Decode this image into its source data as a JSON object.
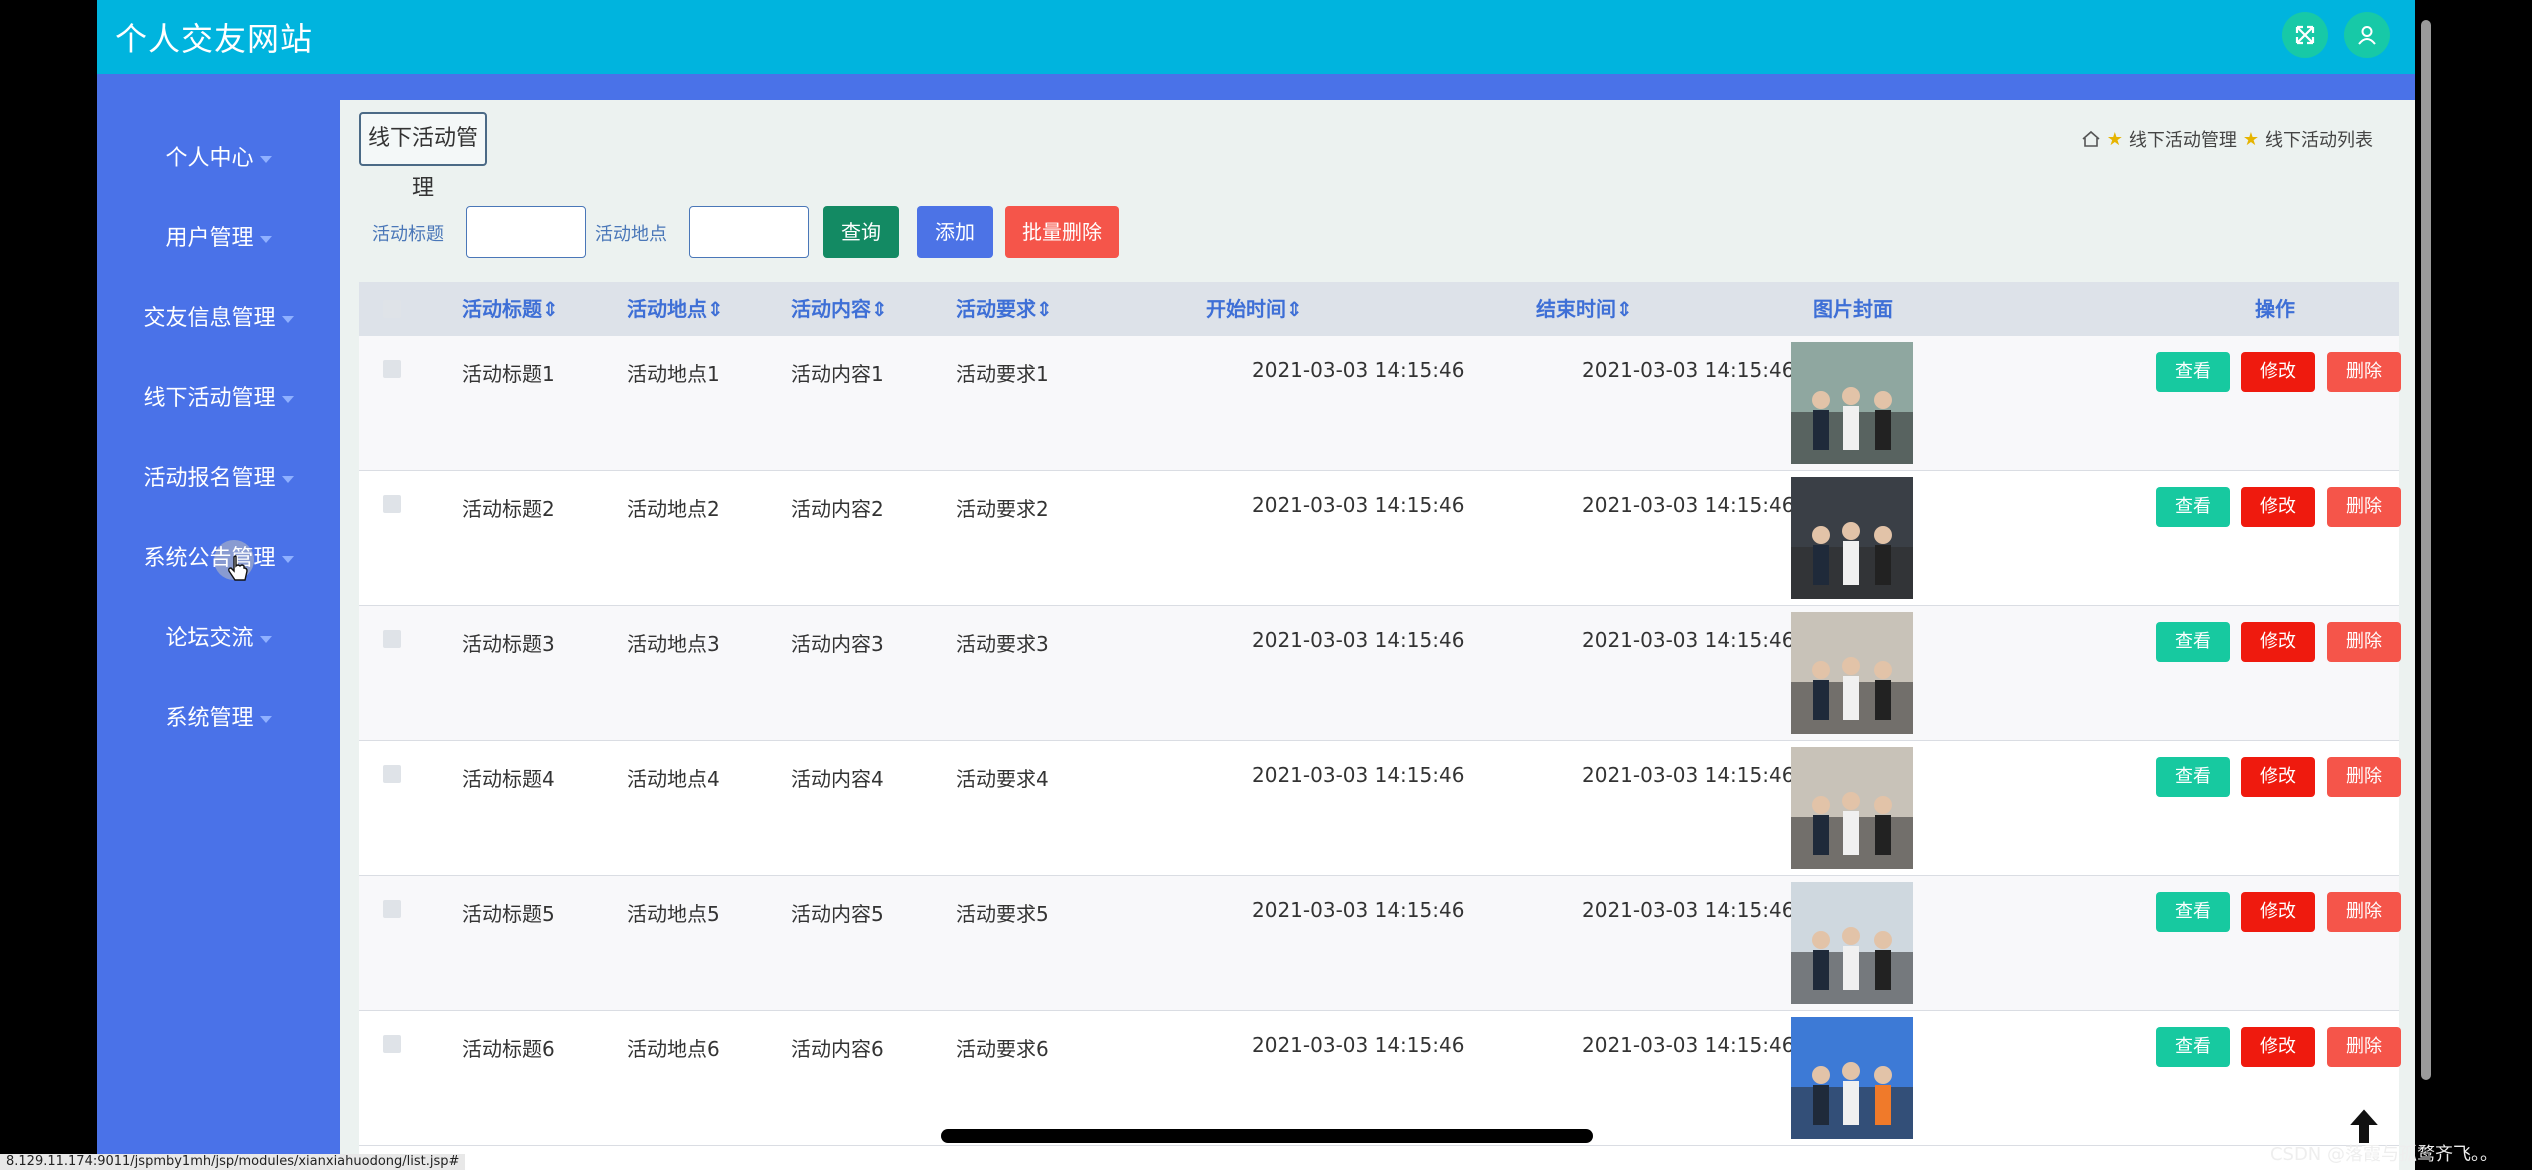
{
  "header": {
    "title": "个人交友网站",
    "fullscreen_icon": "expand-icon",
    "user_icon": "user-icon"
  },
  "sidebar": {
    "items": [
      {
        "label": "个人中心"
      },
      {
        "label": "用户管理"
      },
      {
        "label": "交友信息管理"
      },
      {
        "label": "线下活动管理"
      },
      {
        "label": "活动报名管理"
      },
      {
        "label": "系统公告管理"
      },
      {
        "label": "论坛交流"
      },
      {
        "label": "系统管理"
      }
    ]
  },
  "section_button": "线下活动管理",
  "breadcrumb": {
    "level1": "线下活动管理",
    "level2": "线下活动列表"
  },
  "search": {
    "title_label": "活动标题",
    "place_label": "活动地点",
    "query_button": "查询",
    "add_button": "添加",
    "batch_delete_button": "批量删除"
  },
  "table": {
    "headers": {
      "title": "活动标题",
      "place": "活动地点",
      "content": "活动内容",
      "requirement": "活动要求",
      "start": "开始时间",
      "end": "结束时间",
      "cover": "图片封面",
      "actions": "操作"
    },
    "rows": [
      {
        "title": "活动标题1",
        "place": "活动地点1",
        "content": "活动内容1",
        "requirement": "活动要求1",
        "start": "2021-03-03 14:15:46",
        "end": "2021-03-03 14:15:46"
      },
      {
        "title": "活动标题2",
        "place": "活动地点2",
        "content": "活动内容2",
        "requirement": "活动要求2",
        "start": "2021-03-03 14:15:46",
        "end": "2021-03-03 14:15:46"
      },
      {
        "title": "活动标题3",
        "place": "活动地点3",
        "content": "活动内容3",
        "requirement": "活动要求3",
        "start": "2021-03-03 14:15:46",
        "end": "2021-03-03 14:15:46"
      },
      {
        "title": "活动标题4",
        "place": "活动地点4",
        "content": "活动内容4",
        "requirement": "活动要求4",
        "start": "2021-03-03 14:15:46",
        "end": "2021-03-03 14:15:46"
      },
      {
        "title": "活动标题5",
        "place": "活动地点5",
        "content": "活动内容5",
        "requirement": "活动要求5",
        "start": "2021-03-03 14:15:46",
        "end": "2021-03-03 14:15:46"
      },
      {
        "title": "活动标题6",
        "place": "活动地点6",
        "content": "活动内容6",
        "requirement": "活动要求6",
        "start": "2021-03-03 14:15:46",
        "end": "2021-03-03 14:15:46"
      }
    ],
    "row_actions": {
      "view": "查看",
      "edit": "修改",
      "delete": "删除"
    }
  },
  "status_url": "8.129.11.174:9011/jspmby1mh/jsp/modules/xianxiahuodong/list.jsp#",
  "watermark": "CSDN @落霞与孤鹜齐飞。。",
  "colors": {
    "header": "#00b4de",
    "sidebar": "#4a72e8",
    "query": "#138a63",
    "add": "#4c73e6",
    "batch_delete": "#f5554a",
    "view": "#17c9a0",
    "edit": "#ef1a0e",
    "delete": "#f5554a"
  }
}
